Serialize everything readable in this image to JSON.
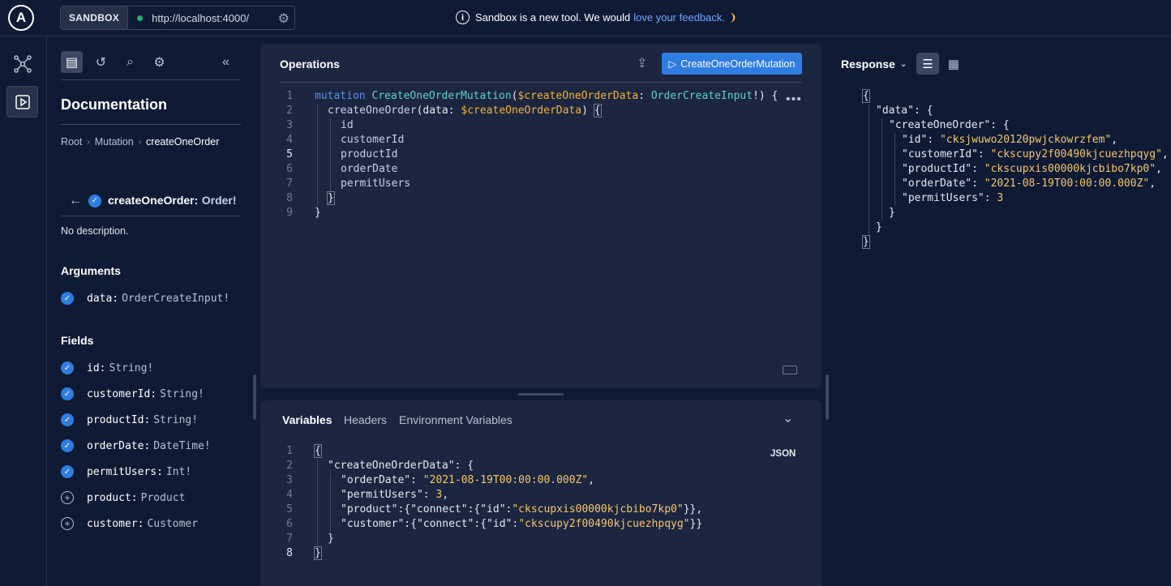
{
  "topbar": {
    "logo": "A",
    "sandbox_label": "SANDBOX",
    "url": "http://localhost:4000/",
    "notice_text": "Sandbox is a new tool. We would",
    "notice_link": "love your feedback.",
    "accent": "#2f7de1",
    "status_color": "#21b36b"
  },
  "rail": {
    "items": [
      {
        "icon": "graph-icon"
      },
      {
        "icon": "play-icon",
        "active": true
      }
    ]
  },
  "docs": {
    "tools": [
      "document-icon",
      "history-icon",
      "search-icon",
      "gear-icon"
    ],
    "collapse_icon": "double-chevron-left-icon",
    "title": "Documentation",
    "breadcrumb": [
      "Root",
      "Mutation",
      "createOneOrder"
    ],
    "field": {
      "name": "createOneOrder:",
      "type": "Order!"
    },
    "description": "No description.",
    "arguments_heading": "Arguments",
    "arguments": [
      {
        "name": "data:",
        "type": "OrderCreateInput!",
        "checked": true
      }
    ],
    "fields_heading": "Fields",
    "fields": [
      {
        "name": "id:",
        "type": "String!",
        "checked": true
      },
      {
        "name": "customerId:",
        "type": "String!",
        "checked": true
      },
      {
        "name": "productId:",
        "type": "String!",
        "checked": true
      },
      {
        "name": "orderDate:",
        "type": "DateTime!",
        "checked": true
      },
      {
        "name": "permitUsers:",
        "type": "Int!",
        "checked": true
      },
      {
        "name": "product:",
        "type": "Product",
        "checked": false
      },
      {
        "name": "customer:",
        "type": "Customer",
        "checked": false
      }
    ]
  },
  "operations": {
    "title": "Operations",
    "run_label": "CreateOneOrderMutation",
    "line_numbers": [
      "1",
      "2",
      "3",
      "4",
      "5",
      "6",
      "7",
      "8",
      "9"
    ],
    "code": {
      "kw_mutation": "mutation",
      "op_name": "CreateOneOrderMutation",
      "paren_open": "(",
      "var_name": "$createOneOrderData",
      "colon": ": ",
      "type_name": "OrderCreateInput",
      "bang_close": "!) {",
      "l2_field": "createOneOrder",
      "l2_args_open": "(data: ",
      "l2_var": "$createOneOrderData",
      "l2_close": ") ",
      "l2_brace": "{",
      "fields": [
        "id",
        "customerId",
        "productId",
        "orderDate",
        "permitUsers"
      ],
      "l8": "}",
      "l9": "}"
    }
  },
  "variables": {
    "tabs": [
      "Variables",
      "Headers",
      "Environment Variables"
    ],
    "format": "JSON",
    "line_numbers": [
      "1",
      "2",
      "3",
      "4",
      "5",
      "6",
      "7",
      "8"
    ],
    "lines": {
      "l1": "{",
      "l2_key": "\"createOneOrderData\"",
      "l2_rest": ": {",
      "l3_key": "\"orderDate\"",
      "l3_val": "\"2021-08-19T00:00:00.000Z\"",
      "l4_key": "\"permitUsers\"",
      "l4_val": "3",
      "l5_key": "\"product\"",
      "l5_mid": ":{",
      "l5_k2": "\"connect\"",
      "l5_m2": ":{",
      "l5_k3": "\"id\"",
      "l5_colon": ":",
      "l5_val": "\"ckscupxis00000kjcbibo7kp0\"",
      "l5_end": "}},",
      "l6_key": "\"customer\"",
      "l6_k2": "\"connect\"",
      "l6_k3": "\"id\"",
      "l6_val": "\"ckscupy2f00490kjcuezhpqyg\"",
      "l6_end": "}}",
      "l7": "}",
      "l8": "}"
    }
  },
  "response": {
    "title": "Response",
    "view_buttons": [
      "json-view-icon",
      "table-view-icon"
    ],
    "lines": {
      "l1": "{",
      "l2_key": "\"data\"",
      "l2_rest": ": {",
      "l3_key": "\"createOneOrder\"",
      "l3_rest": ": {",
      "l4_key": "\"id\"",
      "l4_val": "\"cksjwuwo20120pwjckowrzfem\"",
      "l5_key": "\"customerId\"",
      "l5_val": "\"ckscupy2f00490kjcuezhpqyg\"",
      "l6_key": "\"productId\"",
      "l6_val": "\"ckscupxis00000kjcbibo7kp0\"",
      "l7_key": "\"orderDate\"",
      "l7_val": "\"2021-08-19T00:00:00.000Z\"",
      "l8_key": "\"permitUsers\"",
      "l8_val": "3",
      "l9": "}",
      "l10": "}",
      "l11": "}"
    }
  }
}
